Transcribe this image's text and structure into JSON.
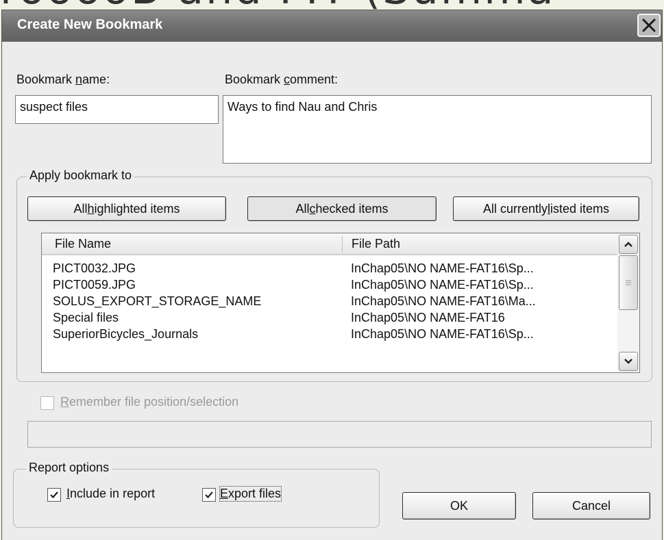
{
  "background_heading": "rooooB and FIT (Summa",
  "dialog": {
    "title": "Create New Bookmark",
    "close_glyph": "✕"
  },
  "bookmark_name": {
    "label_pre": "Bookmark ",
    "label_key": "n",
    "label_post": "ame:",
    "value": "suspect files"
  },
  "bookmark_comment": {
    "label_pre": "Bookmark ",
    "label_key": "c",
    "label_post": "omment:",
    "value": "Ways to find Nau and Chris"
  },
  "apply_group": {
    "label": "Apply bookmark to",
    "buttons": [
      {
        "pre": "All ",
        "key": "h",
        "post": "ighlighted items"
      },
      {
        "pre": "All ",
        "key": "c",
        "post": "hecked items"
      },
      {
        "pre": "All currently ",
        "key": "l",
        "post": "isted items"
      }
    ]
  },
  "file_list": {
    "columns": [
      "File Name",
      "File Path"
    ],
    "rows": [
      {
        "name": "PICT0032.JPG",
        "path": "InChap05\\NO NAME-FAT16\\Sp..."
      },
      {
        "name": "PICT0059.JPG",
        "path": "InChap05\\NO NAME-FAT16\\Sp..."
      },
      {
        "name": "SOLUS_EXPORT_STORAGE_NAME",
        "path": "InChap05\\NO NAME-FAT16\\Ma..."
      },
      {
        "name": "Special files",
        "path": "InChap05\\NO NAME-FAT16"
      },
      {
        "name": "SuperiorBicycles_Journals",
        "path": "InChap05\\NO NAME-FAT16\\Sp..."
      }
    ]
  },
  "remember": {
    "key": "R",
    "post": "emember file position/selection",
    "checked": false
  },
  "report_options": {
    "label": "Report options",
    "include": {
      "key": "I",
      "post": "nclude in report",
      "checked": true
    },
    "export": {
      "key": "E",
      "post": "xport files",
      "checked": true
    }
  },
  "buttons": {
    "ok": "OK",
    "cancel": "Cancel"
  },
  "colors": {
    "titlebar": "#6f6f6f",
    "dialog_bg": "#ececec",
    "page_bg": "#f1f2e6"
  },
  "icons": {
    "close": "close-icon",
    "scroll_up": "chevron-up-icon",
    "scroll_down": "chevron-down-icon",
    "grip": "grip-icon",
    "check": "checkmark-icon"
  }
}
